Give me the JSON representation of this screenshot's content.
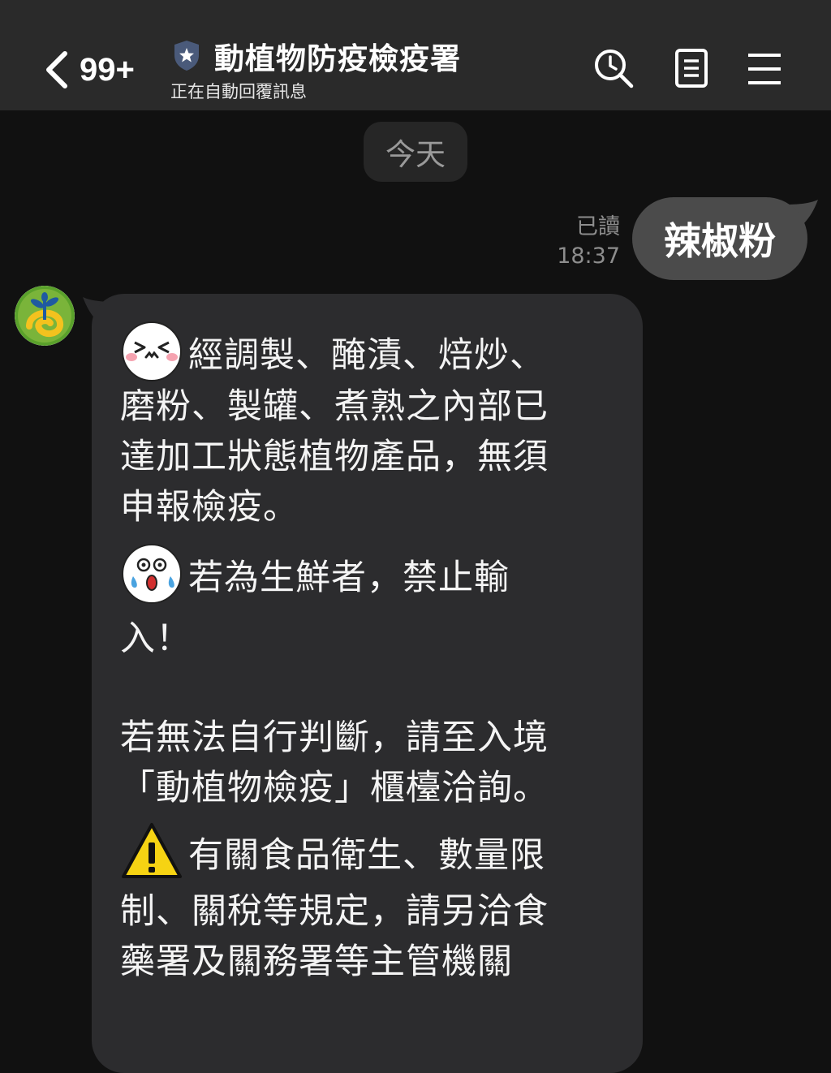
{
  "header": {
    "unread_count": "99+",
    "title": "動植物防疫檢疫署",
    "subtitle": "正在自動回覆訊息",
    "icons": [
      "chevron-left-icon",
      "shield-star-icon",
      "search-icon",
      "notes-icon",
      "menu-icon"
    ]
  },
  "chat": {
    "date_label": "今天",
    "sent": {
      "read_status": "已讀",
      "time": "18:37",
      "text": "辣椒粉"
    },
    "reply": {
      "avatar_icon": "plant-logo-icon",
      "para1_line1": "經調製、醃漬、焙炒、",
      "para1_line2": "磨粉、製罐、煮熟之內部已",
      "para1_line3": "達加工狀態植物產品，無須",
      "para1_line4": "申報檢疫。",
      "para2_line1": "若為生鮮者，禁止輸",
      "para2_line2": "入！",
      "para3_line1": "若無法自行判斷，請至入境",
      "para3_line2": "「動植物檢疫」櫃檯洽詢。",
      "para4_line1": "有關食品衛生、數量限",
      "para4_line2": "制、關稅等規定，請另洽食",
      "para4_line3": "藥署及關務署等主管機關",
      "emoji_icons": [
        "laughing-face-emoji",
        "shocked-crying-face-emoji",
        "warning-sign-emoji"
      ]
    }
  },
  "colors": {
    "header_bg": "#2a2a2a",
    "chat_bg": "#111111",
    "incoming_bubble": "#2c2c2e",
    "outgoing_bubble": "#4b4b4b",
    "meta_text": "#8d8d8d"
  }
}
